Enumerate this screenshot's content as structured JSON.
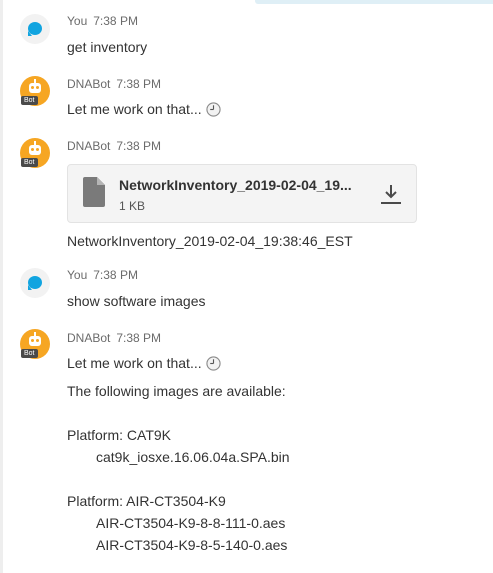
{
  "colors": {
    "user_avatar_bubble": "#11a4e0",
    "bot_avatar": "#f6a623",
    "text": "#333333",
    "meta": "#6b6b6b"
  },
  "messages": [
    {
      "sender": "You",
      "time": "7:38 PM",
      "text": "get inventory",
      "avatar_icon": "chat-bubble-icon"
    },
    {
      "sender": "DNABot",
      "time": "7:38 PM",
      "text": "Let me work on that...",
      "avatar_icon": "bot-icon",
      "avatar_tag": "Bot",
      "status_icon": "clock-icon"
    },
    {
      "sender": "DNABot",
      "time": "7:38 PM",
      "avatar_icon": "bot-icon",
      "avatar_tag": "Bot",
      "file": {
        "name": "NetworkInventory_2019-02-04_19...",
        "size": "1 KB",
        "icon": "file-icon",
        "action_icon": "download-icon"
      },
      "caption": "NetworkInventory_2019-02-04_19:38:46_EST"
    },
    {
      "sender": "You",
      "time": "7:38 PM",
      "text": "show software images",
      "avatar_icon": "chat-bubble-icon"
    },
    {
      "sender": "DNABot",
      "time": "7:38 PM",
      "avatar_icon": "bot-icon",
      "avatar_tag": "Bot",
      "text": "Let me work on that...",
      "status_icon": "clock-icon",
      "body_intro": "The following images are available:",
      "platforms": [
        {
          "label": "Platform: CAT9K",
          "images": [
            "cat9k_iosxe.16.06.04a.SPA.bin"
          ]
        },
        {
          "label": "Platform: AIR-CT3504-K9",
          "images": [
            "AIR-CT3504-K9-8-8-111-0.aes",
            "AIR-CT3504-K9-8-5-140-0.aes"
          ]
        }
      ]
    }
  ]
}
